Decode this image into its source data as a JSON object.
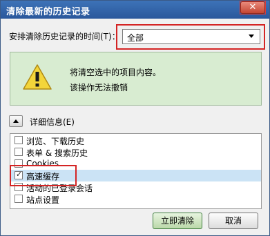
{
  "dialog": {
    "title": "清除最新的历史记录",
    "close_glyph": "✕"
  },
  "range": {
    "label": "安排清除历史记录的时间(T)：",
    "value": "全部"
  },
  "warning": {
    "line1": "将清空选中的项目内容。",
    "line2": "该操作无法撤销"
  },
  "details": {
    "label": "详细信息(E)"
  },
  "items": [
    {
      "label": "浏览、下载历史",
      "checked": false
    },
    {
      "label": "表单 & 搜索历史",
      "checked": false
    },
    {
      "label": "Cookies",
      "checked": false
    },
    {
      "label": "高速缓存",
      "checked": true
    },
    {
      "label": "活动的已登录会话",
      "checked": false
    },
    {
      "label": "站点设置",
      "checked": false
    }
  ],
  "buttons": {
    "clear_now": "立即清除",
    "cancel": "取消"
  },
  "colors": {
    "titlebar": "#2a579b",
    "highlight_box": "#d42424",
    "warning_bg": "#d8ecd1",
    "selected_row": "#cbe3f5"
  }
}
